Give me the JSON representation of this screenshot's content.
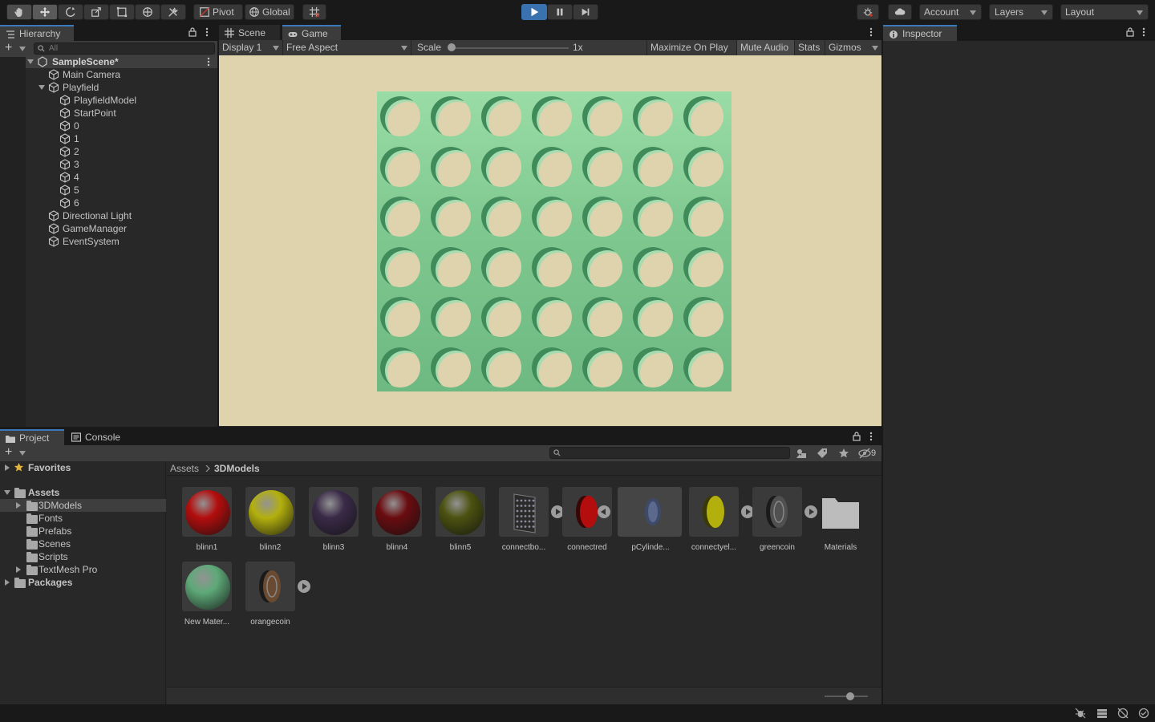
{
  "toolbar": {
    "pivot": "Pivot",
    "global": "Global",
    "account": "Account",
    "layers": "Layers",
    "layout": "Layout"
  },
  "hierarchy": {
    "tab": "Hierarchy",
    "search_placeholder": "All",
    "scene": "SampleScene*",
    "items": [
      "Main Camera",
      "Playfield",
      "PlayfieldModel",
      "StartPoint",
      "0",
      "1",
      "2",
      "3",
      "4",
      "5",
      "6",
      "Directional Light",
      "GameManager",
      "EventSystem"
    ]
  },
  "center": {
    "tab_scene": "Scene",
    "tab_game": "Game",
    "display": "Display 1",
    "aspect": "Free Aspect",
    "scale_label": "Scale",
    "scale_value": "1x",
    "maximize": "Maximize On Play",
    "mute": "Mute Audio",
    "stats": "Stats",
    "gizmos": "Gizmos"
  },
  "inspector": {
    "tab": "Inspector"
  },
  "project": {
    "tab_project": "Project",
    "tab_console": "Console",
    "hidden_count": "9",
    "favorites": "Favorites",
    "assets": "Assets",
    "folders": [
      "3DModels",
      "Fonts",
      "Prefabs",
      "Scenes",
      "Scripts",
      "TextMesh Pro"
    ],
    "packages": "Packages",
    "breadcrumb_root": "Assets",
    "breadcrumb_current": "3DModels",
    "asset_items": [
      {
        "label": "blinn1",
        "color": "#b30d0d"
      },
      {
        "label": "blinn2",
        "color": "#b3b00d"
      },
      {
        "label": "blinn3",
        "color": "#3a2a48"
      },
      {
        "label": "blinn4",
        "color": "#6a0c10"
      },
      {
        "label": "blinn5",
        "color": "#4b5210"
      },
      {
        "label": "connectbo...",
        "color": ""
      },
      {
        "label": "connectred",
        "color": ""
      },
      {
        "label": "pCylinde...",
        "color": ""
      },
      {
        "label": "connectyel...",
        "color": ""
      },
      {
        "label": "greencoin",
        "color": ""
      },
      {
        "label": "Materials",
        "color": ""
      },
      {
        "label": "New Mater...",
        "color": "#5ea978"
      },
      {
        "label": "orangecoin",
        "color": ""
      }
    ]
  }
}
